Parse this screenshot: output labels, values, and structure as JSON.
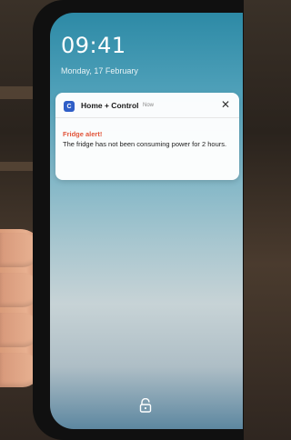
{
  "lockscreen": {
    "time": "09:41",
    "date": "Monday, 17 February"
  },
  "notification": {
    "app_name": "Home + Control",
    "app_icon": "home-control-app-icon",
    "timestamp": "Now",
    "title": "Fridge alert!",
    "body": "The fridge has not been consuming power for 2 hours.",
    "title_color": "#e2553a"
  },
  "icons": {
    "close": "close-icon",
    "lock": "unlock-icon"
  }
}
